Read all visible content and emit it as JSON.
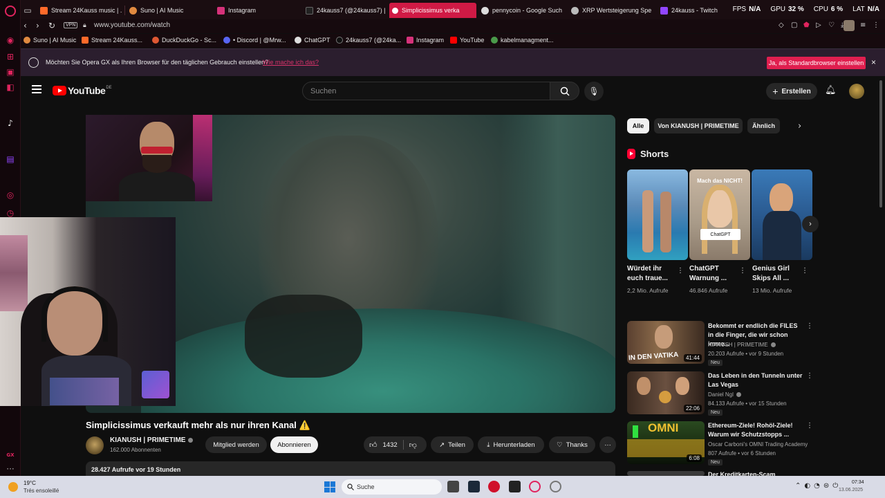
{
  "browser": {
    "tabs": [
      {
        "label": "Stream 24Kauss music | ...",
        "color": "#ff6a2a"
      },
      {
        "label": "Suno | AI Music",
        "color": "#e08a40"
      },
      {
        "label": "Instagram",
        "color": "#d6327a"
      },
      {
        "label": "24kauss7 (@24kauss7) |",
        "color": "#111111"
      },
      {
        "label": "Simplicissimus verka",
        "color": "#ffffff"
      },
      {
        "label": "pennycoin - Google Such",
        "color": "#dddddd"
      },
      {
        "label": "XRP Wertsteigerung Spe",
        "color": "#bbbbbb"
      },
      {
        "label": "24kauss - Twitch",
        "color": "#9146ff"
      }
    ],
    "stats": {
      "fps_label": "FPS",
      "fps_value": "N/A",
      "gpu_label": "GPU",
      "gpu_value": "32 %",
      "cpu_label": "CPU",
      "cpu_value": "6 %",
      "lat_label": "LAT",
      "lat_value": "N/A"
    },
    "vpn_label": "VPN",
    "url": "www.youtube.com/watch",
    "bookmarks": [
      {
        "label": "Suno | AI Music",
        "color": "#e08a40"
      },
      {
        "label": "Stream 24Kauss...",
        "color": "#ff6a2a"
      },
      {
        "label": "DuckDuckGo - Sc...",
        "color": "#de5833"
      },
      {
        "label": "• Discord | @Mrw...",
        "color": "#5865f2"
      },
      {
        "label": "ChatGPT",
        "color": "#dddddd"
      },
      {
        "label": "24kauss7 (@24ka...",
        "color": "#111111"
      },
      {
        "label": "Instagram",
        "color": "#d6327a"
      },
      {
        "label": "YouTube",
        "color": "#ff0000"
      },
      {
        "label": "kabelmanagment...",
        "color": "#4a9a4a"
      }
    ],
    "banner": {
      "text": "Möchten Sie Opera GX als Ihren Browser für den täglichen Gebrauch einstellen?",
      "link": "Wie mache ich das?",
      "button": "Ja, als Standardbrowser einstellen",
      "close": "×"
    }
  },
  "youtube": {
    "logo_text": "YouTube",
    "country": "DE",
    "search_placeholder": "Suchen",
    "create_label": "Erstellen",
    "video": {
      "title": "Simplicissimus verkauft mehr als nur ihren Kanal ⚠️",
      "channel": "KIANUSH | PRIMETIME",
      "subscribers": "162.000 Abonnenten",
      "member_btn": "Mitglied werden",
      "subscribe_btn": "Abonnieren",
      "likes": "1432",
      "share": "Teilen",
      "download": "Herunterladen",
      "thanks": "Thanks",
      "description_meta": "28.427 Aufrufe  vor 19 Stunden"
    },
    "chips": [
      "Alle",
      "Von KIANUSH | PRIMETIME",
      "Ähnlich"
    ],
    "shorts_heading": "Shorts",
    "shorts": [
      {
        "title": "Würdet ihr euch traue...",
        "views": "2,2 Mio. Aufrufe"
      },
      {
        "title": "ChatGPT Warnung ...",
        "views": "46.846 Aufrufe",
        "overlay_top": "Mach das NICHT!",
        "overlay_badge": "ChatGPT"
      },
      {
        "title": "Genius Girl Skips All ...",
        "views": "13 Mio. Aufrufe"
      }
    ],
    "recommendations": [
      {
        "title": "Bekommt er endlich die FILES in die Finger, die wir schon imme...",
        "channel": "KIANUSH | PRIMETIME",
        "meta": "20.203 Aufrufe • vor 9 Stunden",
        "badge": "Neu",
        "duration": "41:44",
        "thumb_text": "IN DEN VATIKA"
      },
      {
        "title": "Das Leben in den Tunneln unter Las Vegas",
        "channel": "Daniel Ngl",
        "meta": "84.133 Aufrufe • vor 15 Stunden",
        "badge": "Neu",
        "duration": "22:06"
      },
      {
        "title": "Ethereum-Ziele! Rohöl-Ziele! Warum wir Schutzstopps ...",
        "channel": "Oscar Carboni's OMNI Trading Academy",
        "meta": "807 Aufrufe • vor 6 Stunden",
        "badge": "Neu",
        "duration": "6:08",
        "thumb_text": "OMNI"
      },
      {
        "title": "Der Kreditkarten-Scam"
      }
    ]
  },
  "taskbar": {
    "temp": "19°C",
    "weather": "Trés ensoleillé",
    "search": "Suche",
    "time": "07:34",
    "date": "13.06.2025"
  },
  "colors": {
    "accent": "#e01f4f",
    "youtube_red": "#ff0000",
    "bg": "#0f0f0f"
  }
}
